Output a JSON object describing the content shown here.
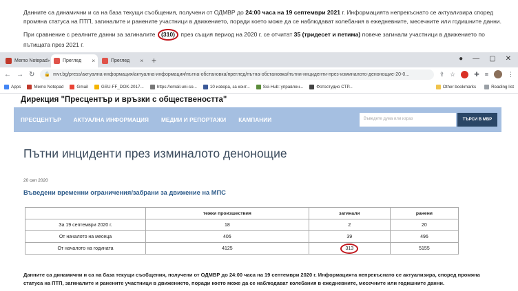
{
  "article_above": {
    "p1_a": "Данните са динамични и са на база текущи съобщения, получени от ОДМВР до ",
    "p1_b": "24:00 часа на 19 септември 2021",
    "p1_c": " г. Информацията непрекъснато се актуализира според промяна статуса на ПТП, загиналите и ранените участници в движението, поради което може да се наблюдават колебания в ежедневните, месечните или годишните данни.",
    "p2_a": "При сравнение с реалните данни за загиналите ",
    "p2_circled": "(310)",
    "p2_b": " през същия период на 2020 г. се отчитат ",
    "p2_bold": "35 (тридесет и петима)",
    "p2_c": " повече загинали участници в движението по пътищата през 2021 г."
  },
  "browser": {
    "tabs": [
      {
        "label": "Memo Notepad",
        "favicon_color": "#c0392b",
        "active": false
      },
      {
        "label": "Преглед",
        "favicon_color": "#e0534a",
        "active": true
      },
      {
        "label": "Преглед",
        "favicon_color": "#e0534a",
        "active": false
      }
    ],
    "new_tab": "+",
    "address": "mvr.bg/press/актуална-информация/актуална-информация/пътна-обстановка/преглед/пътна-обстановка/пътни-инциденти-през-изминалото-денонощие-20-0...",
    "bookmarks": [
      {
        "label": "Apps",
        "color": "#4285f4"
      },
      {
        "label": "Memo Notepad",
        "color": "#c0392b"
      },
      {
        "label": "Gmail",
        "color": "#ea4335"
      },
      {
        "label": "GSU-FF_DOK-2017...",
        "color": "#f4b400"
      },
      {
        "label": "https://email.uni-so...",
        "color": "#777777"
      },
      {
        "label": "10 извора, за конт...",
        "color": "#3b5998"
      },
      {
        "label": "Sci-Hub: управлен...",
        "color": "#5b8c3a"
      },
      {
        "label": "Фотоcтудио СТР...",
        "color": "#444444"
      }
    ],
    "bookmarks_right": [
      "Other bookmarks",
      "Reading list"
    ]
  },
  "site": {
    "header": "Дирекция \"Пресцентър и връзки с обществеността\"",
    "nav": [
      "ПРЕСЦЕНТЪР",
      "АКТУАЛНА ИНФОРМАЦИЯ",
      "МЕДИИ И РЕПОРТАЖИ",
      "КАМПАНИИ"
    ],
    "search_placeholder": "Въведете дума или израз",
    "search_button": "ТЪРСИ В МВР",
    "page_title": "Пътни инциденти през изминалото денонощие",
    "date": "20 сеп 2020",
    "article_title": "Въведени временни ограничения/забрани за движение на МПС",
    "table": {
      "headers": [
        "",
        "тежки произшествия",
        "загинали",
        "ранени"
      ],
      "rows": [
        [
          "За 19 септември 2020 г.",
          "18",
          "2",
          "20"
        ],
        [
          "От началото на месеца",
          "406",
          "39",
          "496"
        ],
        [
          "От началото на годината",
          "4125",
          "313",
          "5155"
        ]
      ]
    },
    "bottom_a": "Данните са динамични и са на база текущи съобщения, получени от ОДМВР до 24:00 часа на 19 септември 2020 г. Информацията непрекъснато се актуализира, според промяна статуса на ПТП, загиналите и ранените участници в движението, поради което може да се наблюдават колебания в ежедневните, месечните или годишните данни."
  }
}
